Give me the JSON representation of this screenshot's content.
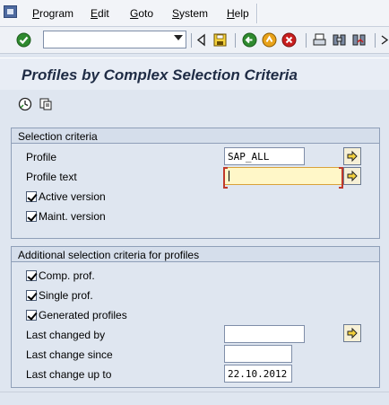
{
  "menu": {
    "items": [
      {
        "label": "Program",
        "accel": "P"
      },
      {
        "label": "Edit",
        "accel": "E"
      },
      {
        "label": "Goto",
        "accel": "G"
      },
      {
        "label": "System",
        "accel": "S"
      },
      {
        "label": "Help",
        "accel": "H"
      }
    ]
  },
  "toolbar": {
    "command_value": ""
  },
  "page": {
    "title": "Profiles by Complex Selection Criteria"
  },
  "selection": {
    "header": "Selection criteria",
    "profile_label": "Profile",
    "profile_value": "SAP_ALL",
    "profile_text_label": "Profile text",
    "profile_text_value": "",
    "active_version_label": "Active version",
    "active_version_checked": true,
    "maint_version_label": "Maint. version",
    "maint_version_checked": true
  },
  "additional": {
    "header": "Additional selection criteria for profiles",
    "comp_prof_label": "Comp. prof.",
    "comp_prof_checked": true,
    "single_prof_label": "Single prof.",
    "single_prof_checked": true,
    "generated_label": "Generated profiles",
    "generated_checked": true,
    "last_changed_by_label": "Last changed by",
    "last_changed_by_value": "",
    "last_change_since_label": "Last change since",
    "last_change_since_value": "",
    "last_change_up_to_label": "Last change up to",
    "last_change_up_to_value": "22.10.2012"
  },
  "colors": {
    "background": "#dfe6f0",
    "title": "#1f2c45",
    "active_field": "#fff7c8",
    "arrow_button": "#f6f0d6"
  }
}
